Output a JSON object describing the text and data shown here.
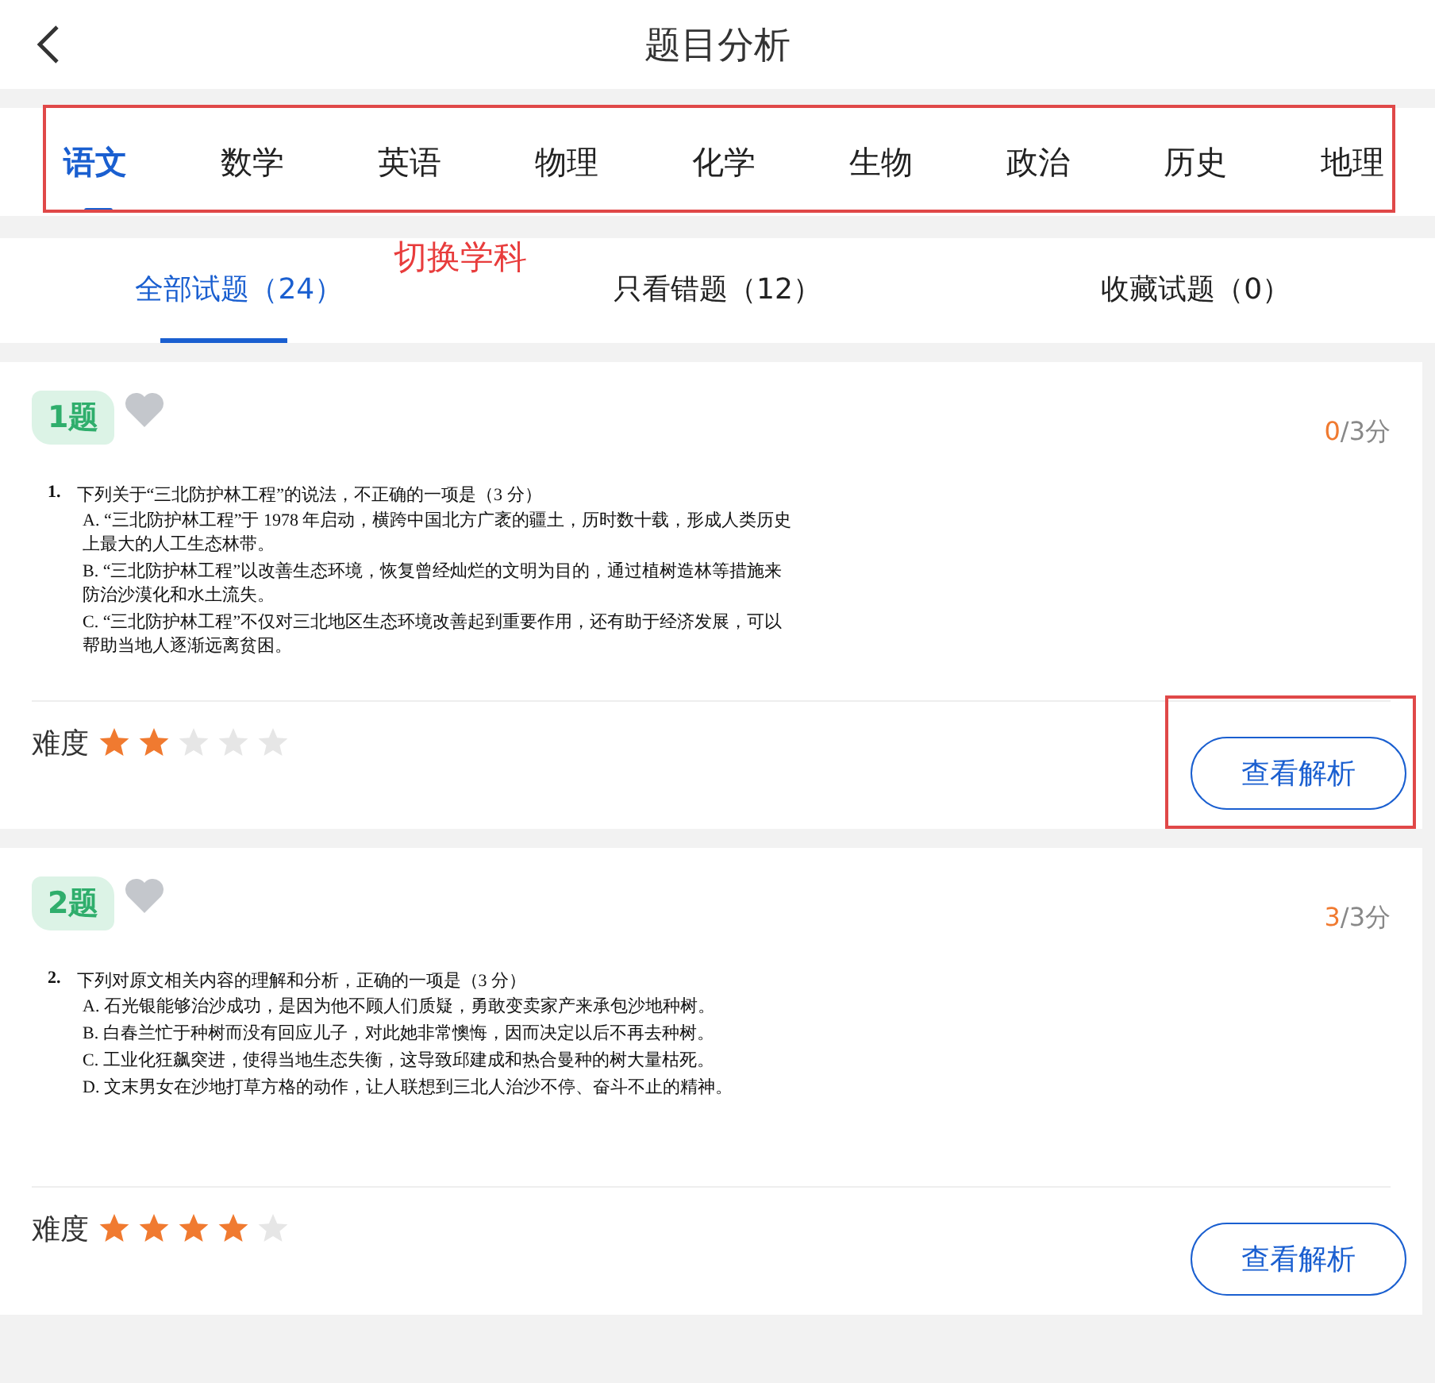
{
  "header": {
    "title": "题目分析"
  },
  "subjects": [
    {
      "label": "语文",
      "selected": true
    },
    {
      "label": "数学",
      "selected": false
    },
    {
      "label": "英语",
      "selected": false
    },
    {
      "label": "物理",
      "selected": false
    },
    {
      "label": "化学",
      "selected": false
    },
    {
      "label": "生物",
      "selected": false
    },
    {
      "label": "政治",
      "selected": false
    },
    {
      "label": "历史",
      "selected": false
    },
    {
      "label": "地理",
      "selected": false
    }
  ],
  "subject_annotation": "切换学科",
  "filters": [
    {
      "label": "全部试题（24）",
      "selected": true
    },
    {
      "label": "只看错题（12）",
      "selected": false
    },
    {
      "label": "收藏试题（0）",
      "selected": false
    }
  ],
  "questions": [
    {
      "number": "1题",
      "favorited": false,
      "score": "0",
      "total": "/3分",
      "num": "1.",
      "stem": "下列关于“三北防护林工程”的说法，不正确的一项是（3 分）",
      "options": [
        "A. “三北防护林工程”于 1978 年启动，横跨中国北方广袤的疆土，历时数十载，形成人类历史上最大的人工生态林带。",
        "B. “三北防护林工程”以改善生态环境，恢复曾经灿烂的文明为目的，通过植树造林等措施来防治沙漠化和水土流失。",
        "C. “三北防护林工程”不仅对三北地区生态环境改善起到重要作用，还有助于经济发展，可以帮助当地人逐渐远离贫困。"
      ],
      "difficulty_label": "难度",
      "stars": 2,
      "button": "查看解析",
      "highlighted": true
    },
    {
      "number": "2题",
      "favorited": false,
      "score": "3",
      "total": "/3分",
      "num": "2.",
      "stem": "下列对原文相关内容的理解和分析，正确的一项是（3 分）",
      "options": [
        "A. 石光银能够治沙成功，是因为他不顾人们质疑，勇敢变卖家产来承包沙地种树。",
        "B. 白春兰忙于种树而没有回应儿子，对此她非常懊悔，因而决定以后不再去种树。",
        "C. 工业化狂飙突进，使得当地生态失衡，这导致邱建成和热合曼种的树大量枯死。",
        "D. 文末男女在沙地打草方格的动作，让人联想到三北人治沙不停、奋斗不止的精神。"
      ],
      "difficulty_label": "难度",
      "stars": 4,
      "button": "查看解析",
      "highlighted": false
    }
  ]
}
